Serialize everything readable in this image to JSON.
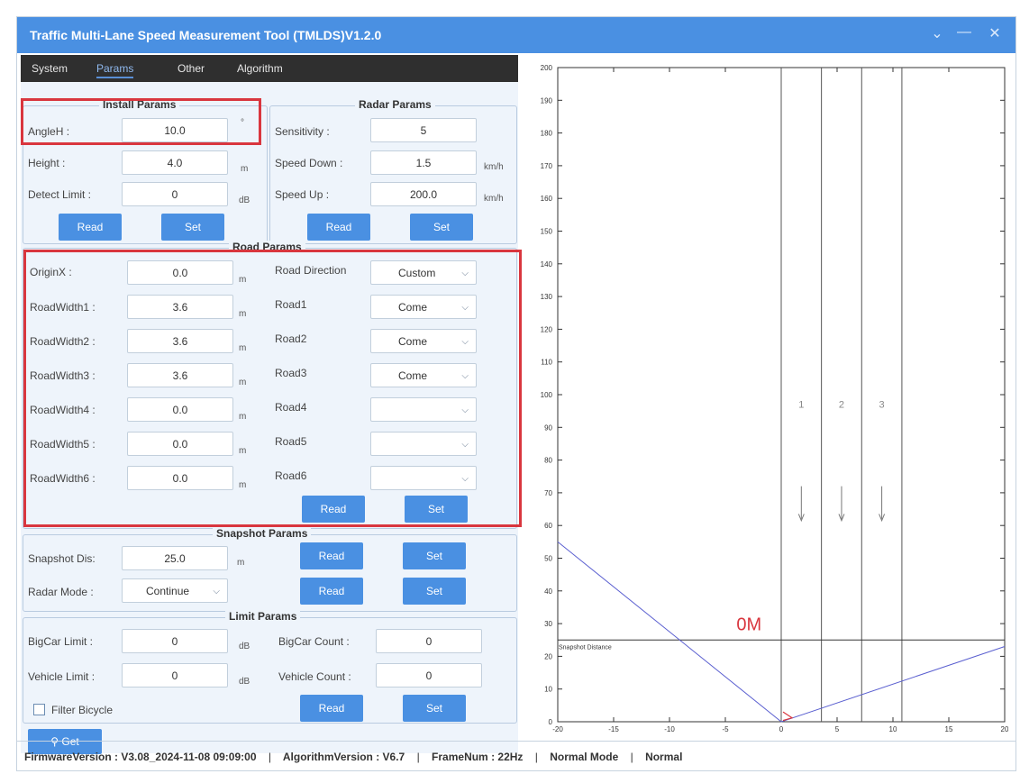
{
  "window": {
    "title": "Traffic Multi-Lane Speed Measurement Tool (TMLDS)V1.2.0"
  },
  "tabs": [
    "System",
    "Params",
    "Other",
    "Algorithm"
  ],
  "install": {
    "title": "Install Params",
    "angle_label": "AngleH :",
    "angle_value": "10.0",
    "angle_unit": "°",
    "height_label": "Height :",
    "height_value": "4.0",
    "height_unit": "m",
    "detect_label": "Detect Limit :",
    "detect_value": "0",
    "detect_unit": "dB",
    "read": "Read",
    "set": "Set"
  },
  "radar": {
    "title": "Radar Params",
    "sens_label": "Sensitivity :",
    "sens_value": "5",
    "down_label": "Speed Down :",
    "down_value": "1.5",
    "down_unit": "km/h",
    "up_label": "Speed Up :",
    "up_value": "200.0",
    "up_unit": "km/h",
    "read": "Read",
    "set": "Set"
  },
  "road": {
    "title": "Road Params",
    "origin_label": "OriginX :",
    "origin_value": "0.0",
    "unit": "m",
    "widths": [
      {
        "label": "RoadWidth1 :",
        "value": "3.6"
      },
      {
        "label": "RoadWidth2 :",
        "value": "3.6"
      },
      {
        "label": "RoadWidth3 :",
        "value": "3.6"
      },
      {
        "label": "RoadWidth4 :",
        "value": "0.0"
      },
      {
        "label": "RoadWidth5 :",
        "value": "0.0"
      },
      {
        "label": "RoadWidth6 :",
        "value": "0.0"
      }
    ],
    "direction_label": "Road Direction",
    "direction_value": "Custom",
    "roads": [
      {
        "label": "Road1",
        "value": "Come"
      },
      {
        "label": "Road2",
        "value": "Come"
      },
      {
        "label": "Road3",
        "value": "Come"
      },
      {
        "label": "Road4",
        "value": ""
      },
      {
        "label": "Road5",
        "value": ""
      },
      {
        "label": "Road6",
        "value": ""
      }
    ],
    "read": "Read",
    "set": "Set"
  },
  "snapshot": {
    "title": "Snapshot Params",
    "dis_label": "Snapshot Dis:",
    "dis_value": "25.0",
    "dis_unit": "m",
    "mode_label": "Radar Mode :",
    "mode_value": "Continue",
    "read": "Read",
    "set": "Set"
  },
  "limit": {
    "title": "Limit Params",
    "bigcar_label": "BigCar Limit :",
    "bigcar_value": "0",
    "bigcar_unit": "dB",
    "bigcount_label": "BigCar Count :",
    "bigcount_value": "0",
    "vehicle_label": "Vehicle Limit :",
    "vehicle_value": "0",
    "vehicle_unit": "dB",
    "vcount_label": "Vehicle Count :",
    "vcount_value": "0",
    "filter_label": "Filter Bicycle",
    "read": "Read",
    "set": "Set"
  },
  "get_button": "Get",
  "status": {
    "firmware": "FirmwareVersion : V3.08_2024-11-08 09:09:00",
    "algorithm": "AlgorithmVersion : V6.7",
    "frame": "FrameNum : 22Hz",
    "mode": "Normal Mode",
    "state": "Normal",
    "sep": "|"
  },
  "colors": {
    "accent": "#4a90e2",
    "highlight": "#d9363e",
    "titlebar": "#4a90e2"
  },
  "chart_data": {
    "type": "line",
    "xlim": [
      -20,
      20
    ],
    "ylim": [
      0,
      200
    ],
    "x_ticks": [
      -20,
      -15,
      -10,
      -5,
      0,
      5,
      10,
      15,
      20
    ],
    "y_ticks": [
      0,
      10,
      20,
      30,
      40,
      50,
      60,
      70,
      80,
      90,
      100,
      110,
      120,
      130,
      140,
      150,
      160,
      170,
      180,
      190,
      200
    ],
    "lane_boundaries_x": [
      0,
      3.6,
      7.2,
      10.8
    ],
    "lane_labels": [
      {
        "text": "1",
        "x": 1.8,
        "y": 96
      },
      {
        "text": "2",
        "x": 5.4,
        "y": 96
      },
      {
        "text": "3",
        "x": 9.0,
        "y": 96
      }
    ],
    "lane_arrows_x": [
      1.8,
      5.4,
      9.0
    ],
    "snapshot_distance": 25,
    "snapshot_label": "Snapshot Distance",
    "origin_label": "0M",
    "detection_cone": {
      "left": [
        [
          -20,
          55
        ],
        [
          0,
          0
        ]
      ],
      "right": [
        [
          0,
          0
        ],
        [
          20,
          23
        ]
      ]
    },
    "grid": false
  }
}
